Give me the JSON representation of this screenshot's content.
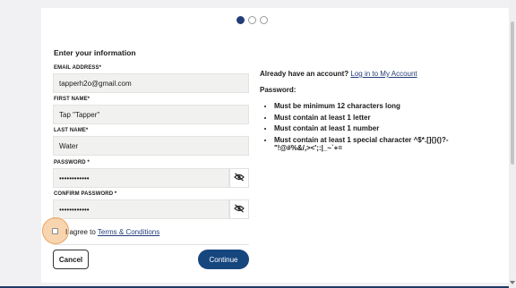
{
  "form": {
    "title": "Enter your information",
    "email": {
      "label": "EMAIL ADDRESS*",
      "value": "tapperh2o@gmail.com"
    },
    "first_name": {
      "label": "FIRST NAME*",
      "value": "Tap \"Tapper\""
    },
    "last_name": {
      "label": "LAST NAME*",
      "value": "Water"
    },
    "password": {
      "label": "PASSWORD *",
      "value": "••••••••••••",
      "toggle_icon": "eye-slash-icon"
    },
    "confirm_password": {
      "label": "CONFIRM PASSWORD *",
      "value": "••••••••••••",
      "toggle_icon": "eye-slash-icon"
    },
    "agree_prefix": "I agree to",
    "terms_link": "Terms & Conditions",
    "cancel_label": "Cancel",
    "continue_label": "Continue"
  },
  "stepper": {
    "total_steps": 3,
    "current_step": 1
  },
  "sidebar": {
    "account_question": "Already have an account?",
    "login_link": "Log in to My Account",
    "password_heading": "Password:",
    "rules": [
      "Must be minimum 12 characters long",
      "Must contain at least 1 letter",
      "Must contain at least 1 number",
      "Must contain at least 1 special character ^$*.[]{}()?-\"!@#%&/,><';:|_~`+="
    ]
  },
  "colors": {
    "primary": "#16467e",
    "active_dot": "#233d78",
    "highlight": "#f2b26e"
  }
}
